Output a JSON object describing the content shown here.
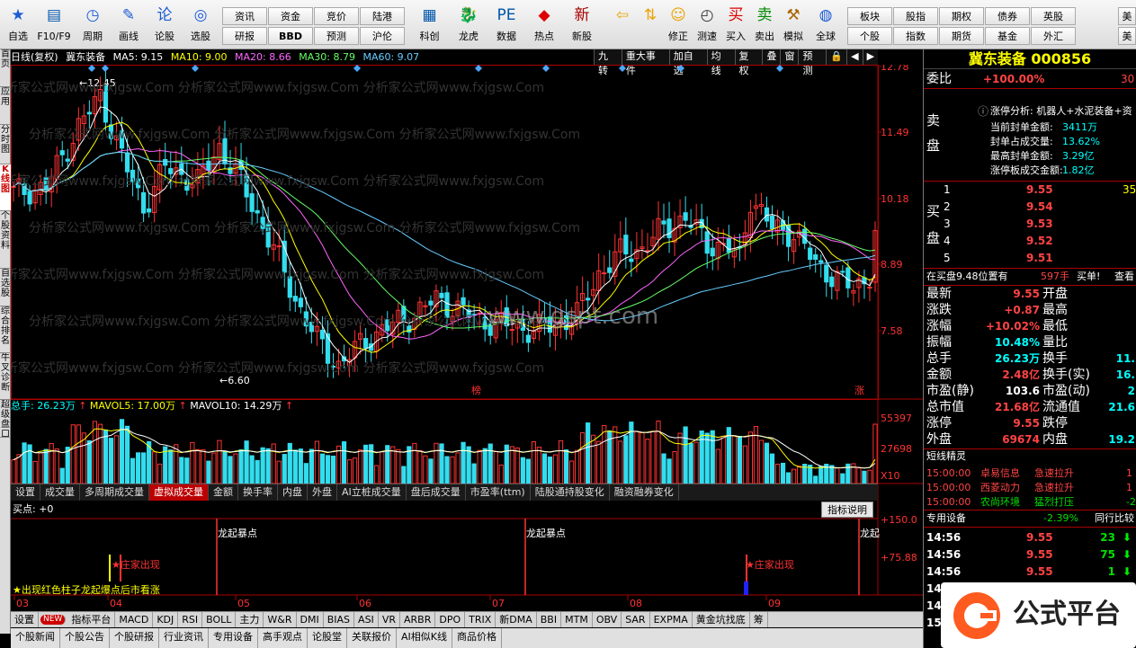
{
  "toolbar": {
    "buttons": [
      {
        "label": "自选",
        "icon": "star-icon"
      },
      {
        "label": "F10/F9",
        "icon": "f10-icon"
      },
      {
        "label": "周期",
        "icon": "clock-icon"
      },
      {
        "label": "画线",
        "icon": "pen-icon"
      },
      {
        "label": "论股",
        "icon": "discuss-icon"
      },
      {
        "label": "选股",
        "icon": "select-icon"
      }
    ],
    "small_buttons_top": [
      "资讯",
      "资金",
      "竞价",
      "陆港"
    ],
    "small_buttons_bottom": [
      "研报",
      "BBD",
      "预测",
      "沪伦"
    ],
    "buttons2": [
      {
        "label": "科创",
        "icon": "chart-icon"
      },
      {
        "label": "龙虎",
        "icon": "dragon-icon"
      },
      {
        "label": "数据",
        "icon": "pe-icon"
      },
      {
        "label": "热点",
        "icon": "hot-icon"
      },
      {
        "label": "新股",
        "icon": "new-stock-icon"
      }
    ],
    "buttons3": [
      {
        "label": "",
        "icon": "arrow-left-icon"
      },
      {
        "label": "",
        "icon": "arrow-updown-icon"
      },
      {
        "label": "修正",
        "icon": "smile-icon"
      },
      {
        "label": "测速",
        "icon": "timer-icon"
      },
      {
        "label": "买入",
        "icon": "buy-icon"
      },
      {
        "label": "卖出",
        "icon": "sell-icon"
      },
      {
        "label": "模拟",
        "icon": "hammer-icon"
      },
      {
        "label": "全球",
        "icon": "globe-icon"
      }
    ],
    "right_top": [
      "板块",
      "股指",
      "期权",
      "债券",
      "英股"
    ],
    "right_bottom": [
      "个股",
      "指数",
      "期货",
      "基金",
      "外汇"
    ],
    "right_edge_top": "美",
    "right_edge_bottom": "美",
    "partial_top": "一",
    "partial_bottom": "一"
  },
  "left_tabs": [
    "首页",
    "应用",
    "分时图",
    "K线图",
    "个股资料",
    "自选股",
    "综合排名",
    "牛叉诊断",
    "超级盘口"
  ],
  "kline_header": {
    "period": "日线(复权)",
    "name": "冀东装备",
    "ma5": "MA5: 9.15",
    "ma10": "MA10: 9.00",
    "ma20": "MA20: 8.66",
    "ma30": "MA30: 8.79",
    "ma60": "MA60: 9.07",
    "buttons": [
      "九转",
      "重大事件",
      "加自选",
      "均线",
      "复权",
      "叠",
      "窗",
      "预测",
      "🔒",
      "◀",
      "▶"
    ]
  },
  "price_axis": [
    "12.78",
    "11.49",
    "10.18",
    "8.89",
    "7.58"
  ],
  "high_label": "12.45",
  "low_label": "6.60",
  "markers": {
    "bang": "榜",
    "zhang": "涨"
  },
  "watermark": "www.gspt.com",
  "watermark_small": "分析家公式网www.fxjgsw.Com",
  "volume_header": {
    "total": "总手: 26.23万",
    "mavol5": "MAVOL5: 17.00万",
    "mavol10": "MAVOL10: 14.29万"
  },
  "volume_axis": [
    "55397",
    "27698",
    "X10"
  ],
  "tabstrip": [
    "设置",
    "成交量",
    "多周期成交量",
    "虚拟成交量",
    "金额",
    "换手率",
    "内盘",
    "外盘",
    "AI立桩成交量",
    "盘后成交量",
    "市盈率(ttm)",
    "陆股通持股变化",
    "融资融券变化"
  ],
  "indicator": {
    "label": "买点: +0",
    "button": "指标说明",
    "axis": [
      "+150.0",
      "+75.88"
    ],
    "texts": [
      "龙起暴点",
      "龙起暴点",
      "龙起"
    ],
    "red_texts": [
      "庄家出现",
      "庄家出现"
    ],
    "legend": "★出现红色柱子龙起爆点后市看涨"
  },
  "months": [
    "03",
    "04",
    "05",
    "06",
    "07",
    "08",
    "09"
  ],
  "bottom_tabs": [
    "设置",
    "NEW",
    "指标平台",
    "MACD",
    "KDJ",
    "RSI",
    "BOLL",
    "主力",
    "W&R",
    "DMI",
    "BIAS",
    "ASI",
    "VR",
    "ARBR",
    "DPO",
    "TRIX",
    "新DMA",
    "BBI",
    "MTM",
    "OBV",
    "SAR",
    "EXPMA",
    "黄金坑找底",
    "筹"
  ],
  "bottom_row2": [
    "个股新闻",
    "个股公告",
    "个股研报",
    "行业资讯",
    "专用设备",
    "高手观点",
    "论股堂",
    "关联报价",
    "AI相似K线",
    "商品价格"
  ],
  "right_panel": {
    "title": "冀东装备 000856",
    "weibi_label": "委比",
    "weibi_value": "+100.00%",
    "weibi_right": "30",
    "sell_label": "卖盘",
    "limit_analysis": "涨停分析: 机器人+水泥装备+资",
    "limit_lines": [
      {
        "k": "当前封单金额:",
        "v": "3411万"
      },
      {
        "k": "封单占成交量:",
        "v": "13.62%"
      },
      {
        "k": "最高封单金额:",
        "v": "3.29亿"
      },
      {
        "k": "涨停板成交金额:",
        "v": "1.82亿"
      }
    ],
    "buy_label": "买盘",
    "buys": [
      {
        "n": "1",
        "p": "9.55",
        "v": "35"
      },
      {
        "n": "2",
        "p": "9.54",
        "v": ""
      },
      {
        "n": "3",
        "p": "9.53",
        "v": ""
      },
      {
        "n": "4",
        "p": "9.52",
        "v": ""
      },
      {
        "n": "5",
        "p": "9.51",
        "v": ""
      }
    ],
    "queue_text": "在买盘9.48位置有",
    "queue_vol": "597手",
    "queue_tag": "买单!",
    "queue_link": "查看",
    "stats": [
      {
        "k1": "最新",
        "v1": "9.55",
        "k2": "开盘",
        "v2": ""
      },
      {
        "k1": "涨跌",
        "v1": "+0.87",
        "k2": "最高",
        "v2": ""
      },
      {
        "k1": "涨幅",
        "v1": "+10.02%",
        "k2": "最低",
        "v2": ""
      },
      {
        "k1": "振幅",
        "v1": "10.48%",
        "k2": "量比",
        "v2": ""
      },
      {
        "k1": "总手",
        "v1": "26.23万",
        "k2": "换手",
        "v2": "11."
      },
      {
        "k1": "金额",
        "v1": "2.48亿",
        "k2": "换手(实)",
        "v2": "16."
      },
      {
        "k1": "市盈(静)",
        "v1": "103.6",
        "k2": "市盈(动)",
        "v2": "2"
      },
      {
        "k1": "总市值",
        "v1": "21.68亿",
        "k2": "流通值",
        "v2": "21.6"
      },
      {
        "k1": "涨停",
        "v1": "9.55",
        "k2": "跌停",
        "v2": ""
      },
      {
        "k1": "外盘",
        "v1": "69674",
        "k2": "内盘",
        "v2": "19.2"
      }
    ],
    "elf_title": "短线精灵",
    "elf_rows": [
      {
        "t": "15:00:00",
        "n": "卓易信息",
        "e": "急速拉升",
        "v": "1"
      },
      {
        "t": "15:00:00",
        "n": "西菱动力",
        "e": "急速拉升",
        "v": "1"
      },
      {
        "t": "15:00:00",
        "n": "农尚环境",
        "e": "猛烈打压",
        "v": "-2"
      }
    ],
    "sector_name": "专用设备",
    "sector_change": "-2.39%",
    "sector_right": "同行比较",
    "ticks": [
      {
        "t": "14:56",
        "p": "9.55",
        "v": "23"
      },
      {
        "t": "14:56",
        "p": "9.55",
        "v": "75"
      },
      {
        "t": "14:56",
        "p": "9.55",
        "v": "1"
      },
      {
        "t": "14:56",
        "p": "9.55",
        "v": "48"
      },
      {
        "t": "14:5",
        "p": "",
        "v": ""
      },
      {
        "t": "15:0",
        "p": "",
        "v": ""
      }
    ]
  },
  "logo_text": "公式平台",
  "colors": {
    "up": "#ff3333",
    "down": "#33ddee",
    "ma5": "#ffffff",
    "ma10": "#ffff00",
    "ma20": "#ff66ff",
    "ma30": "#66ff66",
    "ma60": "#66ccff"
  }
}
